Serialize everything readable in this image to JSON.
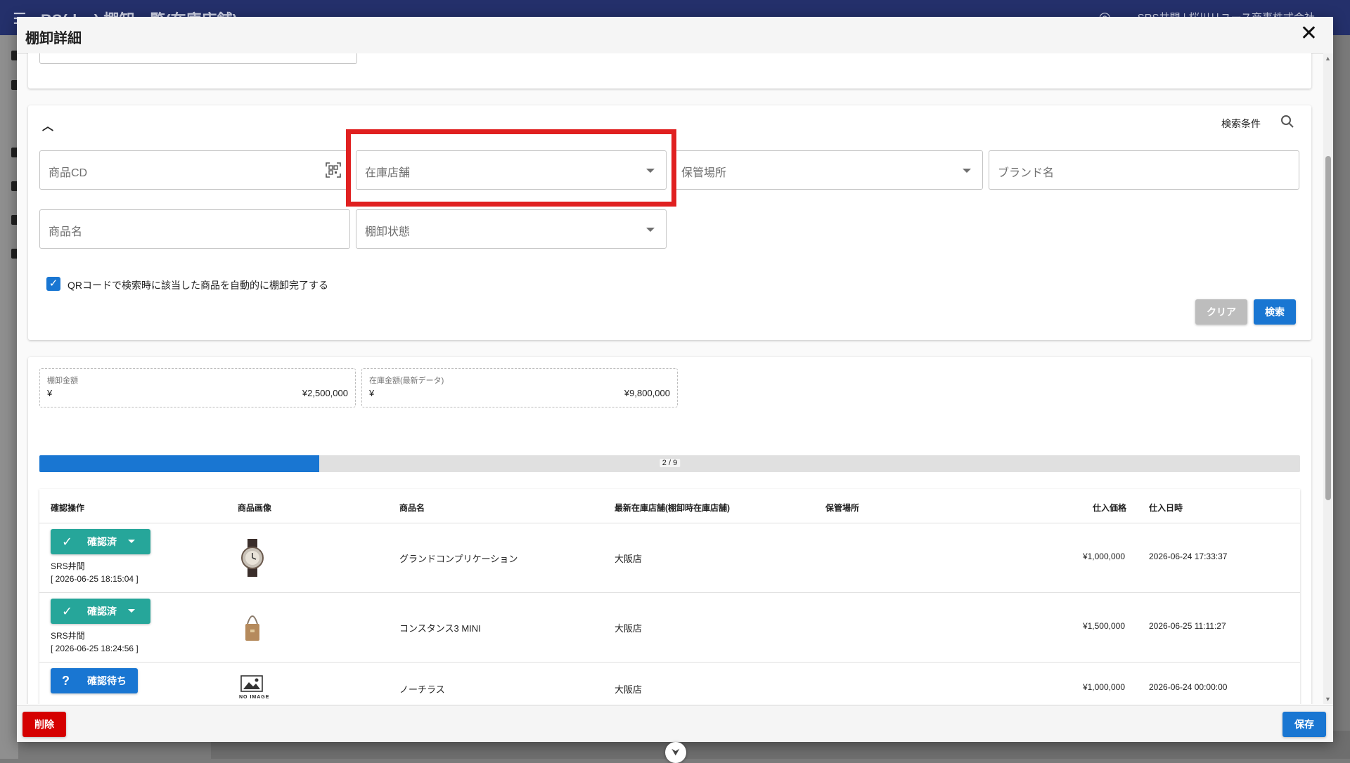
{
  "background_app": {
    "title": "BS(dev) 棚卸一覧(在庫店舗)",
    "user": "SRS井間 | 桜川リユース商事株式会社"
  },
  "dialog": {
    "title": "棚卸詳細"
  },
  "search": {
    "section_label": "検索条件",
    "fields": {
      "product_cd": "商品CD",
      "stock_store": "在庫店舗",
      "storage_location": "保管場所",
      "brand_name": "ブランド名",
      "product_name": "商品名",
      "inventory_status": "棚卸状態"
    },
    "auto_complete_checkbox": {
      "label": "QRコードで検索時に該当した商品を自動的に棚卸完了する",
      "checked": true
    },
    "clear_label": "クリア",
    "search_label": "検索"
  },
  "amounts": {
    "inventory": {
      "label": "棚卸金額",
      "currency": "¥",
      "value": "¥2,500,000"
    },
    "stock": {
      "label": "在庫金額(最新データ)",
      "currency": "¥",
      "value": "¥9,800,000"
    }
  },
  "progress": {
    "text": "2 / 9",
    "done": 2,
    "total": 9
  },
  "table": {
    "columns": [
      "確認操作",
      "商品画像",
      "商品名",
      "最新在庫店舗(棚卸時在庫店舗)",
      "保管場所",
      "仕入価格",
      "仕入日時"
    ],
    "rows": [
      {
        "status": "確認済",
        "user": "SRS井間",
        "timestamp": "[ 2026-06-25 18:15:04 ]",
        "image": "watch-icon",
        "name": "グランドコンプリケーション",
        "store": "大阪店",
        "location": "",
        "price": "¥1,000,000",
        "date": "2026-06-24 17:33:37"
      },
      {
        "status": "確認済",
        "user": "SRS井間",
        "timestamp": "[ 2026-06-25 18:24:56 ]",
        "image": "bag-icon",
        "name": "コンスタンス3 MINI",
        "store": "大阪店",
        "location": "",
        "price": "¥1,500,000",
        "date": "2026-06-25 11:11:27"
      },
      {
        "status": "確認待ち",
        "image": "no-image-icon",
        "no_image_text": "NO IMAGE",
        "name": "ノーチラス",
        "store": "大阪店",
        "location": "",
        "price": "¥1,000,000",
        "date": "2026-06-24 00:00:00"
      }
    ]
  },
  "footer": {
    "delete_label": "削除",
    "save_label": "保存"
  },
  "colors": {
    "primary": "#1976d2",
    "confirmed": "#26a69a",
    "danger": "#d50000",
    "highlight": "#e02020",
    "app_bar": "#24306b"
  }
}
